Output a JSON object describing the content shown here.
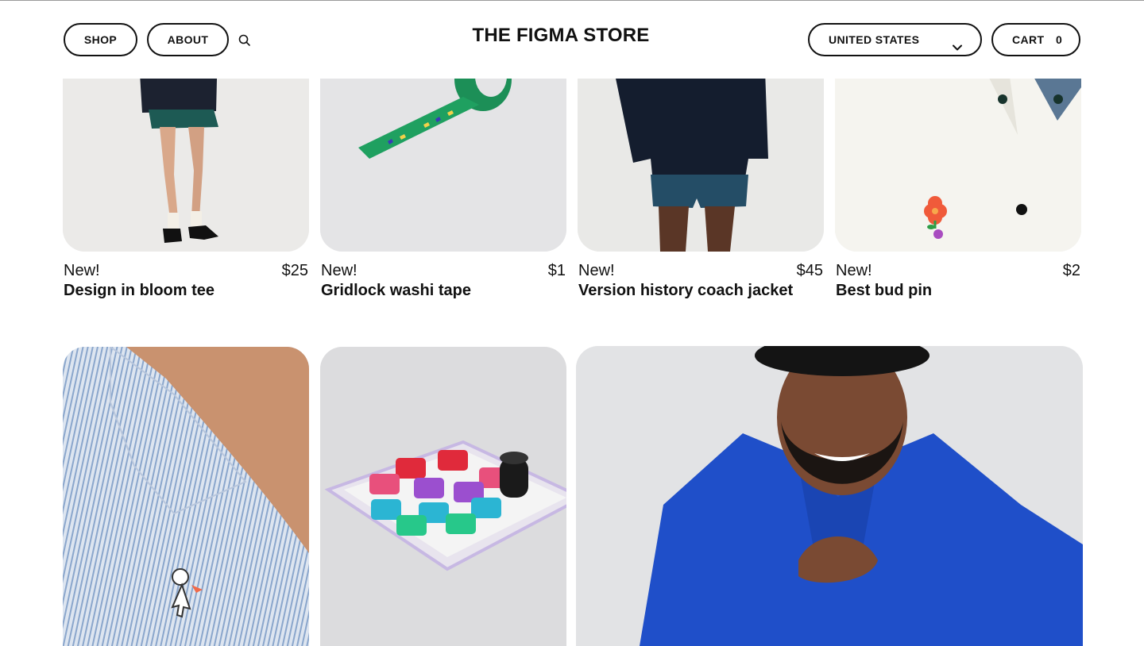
{
  "header": {
    "shop_label": "SHOP",
    "about_label": "ABOUT",
    "search_icon": "search-icon",
    "logo": "THE FIGMA STORE",
    "country_label": "UNITED STATES",
    "country_chevron_icon": "chevron-down-icon",
    "cart_label": "CART",
    "cart_count": "0"
  },
  "products_row1": [
    {
      "badge": "New!",
      "price": "$25",
      "name": "Design in bloom tee"
    },
    {
      "badge": "New!",
      "price": "$1",
      "name": "Gridlock washi tape"
    },
    {
      "badge": "New!",
      "price": "$45",
      "name": "Version history coach jacket"
    },
    {
      "badge": "New!",
      "price": "$2",
      "name": "Best bud pin"
    }
  ],
  "products_row2_images": [
    "cursor-pin-on-striped-shirt-photo",
    "macro-keypad-photo",
    "man-in-blue-jacket-photo"
  ],
  "colors": {
    "text": "#111111",
    "border": "#111111",
    "background": "#ffffff"
  }
}
